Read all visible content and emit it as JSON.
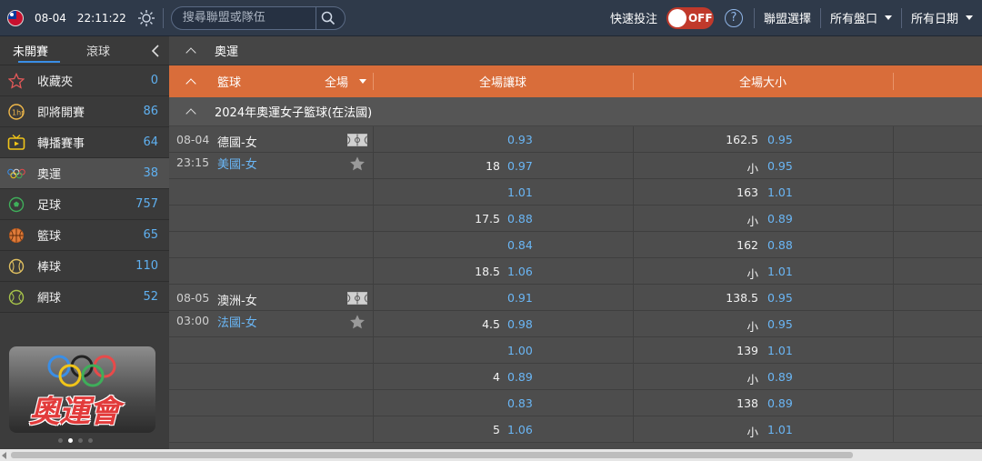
{
  "topbar": {
    "date": "08-04",
    "time": "22:11:22",
    "search_placeholder": "搜尋聯盟或隊伍",
    "quick_bet_label": "快速投注",
    "toggle_state": "OFF",
    "help_label": "?",
    "league_select": "聯盟選擇",
    "all_markets": "所有盤口",
    "all_dates": "所有日期"
  },
  "sidebar": {
    "tabs": [
      "未開賽",
      "滾球"
    ],
    "items": [
      {
        "label": "收藏夾",
        "count": "0",
        "icon": "star-outline-icon"
      },
      {
        "label": "即將開賽",
        "count": "86",
        "icon": "clock-1hr-icon"
      },
      {
        "label": "轉播賽事",
        "count": "64",
        "icon": "tv-icon"
      },
      {
        "label": "奧運",
        "count": "38",
        "icon": "olympic-rings-icon"
      },
      {
        "label": "足球",
        "count": "757",
        "icon": "soccer-ball-icon"
      },
      {
        "label": "籃球",
        "count": "65",
        "icon": "basketball-icon"
      },
      {
        "label": "棒球",
        "count": "110",
        "icon": "baseball-icon"
      },
      {
        "label": "網球",
        "count": "52",
        "icon": "tennis-ball-icon"
      }
    ],
    "banner_text": "奧運會"
  },
  "main": {
    "section_title": "奧運",
    "header": {
      "sport": "籃球",
      "period": "全場",
      "col_handicap": "全場讓球",
      "col_total": "全場大小"
    },
    "league": "2024年奧運女子籃球(在法國)",
    "matches": [
      {
        "date": "08-04",
        "time": "23:15",
        "home": "德國-女",
        "away": "美國-女",
        "lines": [
          {
            "hcap_line": "",
            "hcap_odds": "0.93",
            "total_line": "162.5",
            "total_odds": "0.95"
          },
          {
            "hcap_line": "18",
            "hcap_odds": "0.97",
            "total_line": "小",
            "total_odds": "0.95"
          },
          {
            "hcap_line": "",
            "hcap_odds": "1.01",
            "total_line": "163",
            "total_odds": "1.01"
          },
          {
            "hcap_line": "17.5",
            "hcap_odds": "0.88",
            "total_line": "小",
            "total_odds": "0.89"
          },
          {
            "hcap_line": "",
            "hcap_odds": "0.84",
            "total_line": "162",
            "total_odds": "0.88"
          },
          {
            "hcap_line": "18.5",
            "hcap_odds": "1.06",
            "total_line": "小",
            "total_odds": "1.01"
          }
        ]
      },
      {
        "date": "08-05",
        "time": "03:00",
        "home": "澳洲-女",
        "away": "法國-女",
        "lines": [
          {
            "hcap_line": "",
            "hcap_odds": "0.91",
            "total_line": "138.5",
            "total_odds": "0.95"
          },
          {
            "hcap_line": "4.5",
            "hcap_odds": "0.98",
            "total_line": "小",
            "total_odds": "0.95"
          },
          {
            "hcap_line": "",
            "hcap_odds": "1.00",
            "total_line": "139",
            "total_odds": "1.01"
          },
          {
            "hcap_line": "4",
            "hcap_odds": "0.89",
            "total_line": "小",
            "total_odds": "0.89"
          },
          {
            "hcap_line": "",
            "hcap_odds": "0.83",
            "total_line": "138",
            "total_odds": "0.89"
          },
          {
            "hcap_line": "5",
            "hcap_odds": "1.06",
            "total_line": "小",
            "total_odds": "1.01"
          }
        ]
      }
    ]
  },
  "colors": {
    "topbar_bg": "#2f3a4a",
    "header_orange": "#d96d3a",
    "odds_blue": "#6ab6f5",
    "toggle_red": "#c0392b"
  }
}
